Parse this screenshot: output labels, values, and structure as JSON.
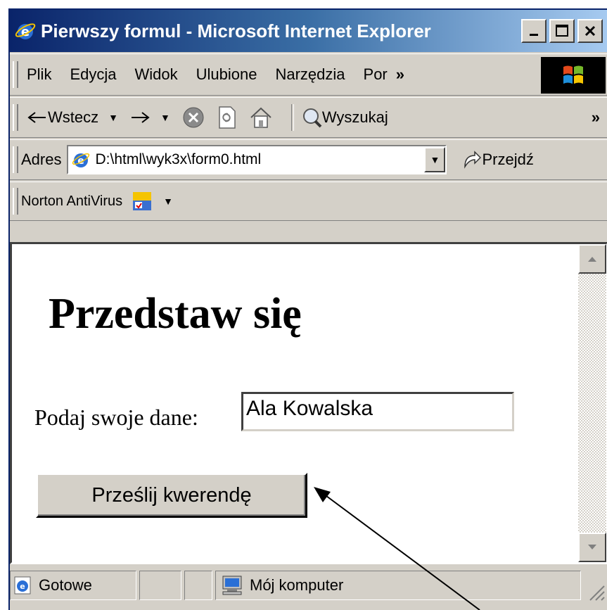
{
  "window": {
    "title": "Pierwszy formul - Microsoft Internet Explorer",
    "colors": {
      "title_bar_start": "#0a246a",
      "title_bar_end": "#a6caf0",
      "chrome": "#d4d0c8"
    }
  },
  "menubar": {
    "items": [
      {
        "label": "Plik"
      },
      {
        "label": "Edycja"
      },
      {
        "label": "Widok"
      },
      {
        "label": "Ulubione"
      },
      {
        "label": "Narzędzia"
      },
      {
        "label": "Por"
      }
    ],
    "overflow": "»"
  },
  "toolbar": {
    "back_label": "Wstecz",
    "search_label": "Wyszukaj",
    "overflow": "»"
  },
  "address": {
    "label": "Adres",
    "value": "D:\\html\\wyk3x\\form0.html",
    "go_label": "Przejdź"
  },
  "norton": {
    "label": "Norton AntiVirus"
  },
  "page": {
    "heading": "Przedstaw się",
    "field_label": "Podaj swoje dane:",
    "field_value": "Ala Kowalska",
    "submit_label": "Prześlij kwerendę"
  },
  "statusbar": {
    "status": "Gotowe",
    "zone": "Mój komputer"
  },
  "icons": [
    "ie-icon",
    "minimize-icon",
    "maximize-icon",
    "close-icon",
    "windows-logo-icon",
    "back-arrow-icon",
    "forward-arrow-icon",
    "stop-icon",
    "refresh-icon",
    "home-icon",
    "search-icon",
    "go-arrow-icon",
    "norton-icon",
    "scroll-up-icon",
    "scroll-down-icon",
    "computer-icon",
    "resize-grip-icon"
  ]
}
